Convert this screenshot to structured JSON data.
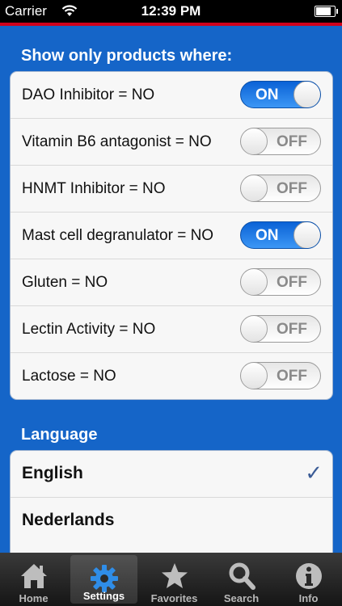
{
  "status_bar": {
    "carrier": "Carrier",
    "time": "12:39 PM",
    "battery_percent": 90
  },
  "filters": {
    "header": "Show only products where:",
    "items": [
      {
        "label": "DAO Inhibitor = NO",
        "state": "ON"
      },
      {
        "label": "Vitamin B6 antagonist = NO",
        "state": "OFF"
      },
      {
        "label": "HNMT Inhibitor = NO",
        "state": "OFF"
      },
      {
        "label": "Mast cell degranulator = NO",
        "state": "ON"
      },
      {
        "label": "Gluten = NO",
        "state": "OFF"
      },
      {
        "label": "Lectin Activity = NO",
        "state": "OFF"
      },
      {
        "label": "Lactose = NO",
        "state": "OFF"
      }
    ]
  },
  "language": {
    "header": "Language",
    "options": [
      {
        "label": "English",
        "selected": true,
        "check": "✓"
      },
      {
        "label": "Nederlands",
        "selected": false
      }
    ]
  },
  "tabbar": {
    "active": "Settings",
    "tabs": [
      {
        "label": "Home",
        "icon": "home-icon"
      },
      {
        "label": "Settings",
        "icon": "gear-icon"
      },
      {
        "label": "Favorites",
        "icon": "star-icon"
      },
      {
        "label": "Search",
        "icon": "search-icon"
      },
      {
        "label": "Info",
        "icon": "info-icon"
      }
    ]
  },
  "colors": {
    "background": "#1565c8",
    "accent_on": "#1a74e8",
    "status_line": "#d0021b"
  }
}
